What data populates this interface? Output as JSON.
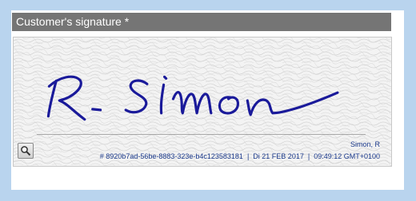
{
  "header": {
    "title": "Customer's signature *"
  },
  "signature": {
    "signer_name": "Simon, R",
    "hash": "# 8920b7ad-56be-8883-323e-b4c123583181",
    "date": "Di 21 FEB 2017",
    "time": "09:49:12 GMT+0100",
    "separator": "|",
    "ink_color": "#1a1a9a"
  },
  "tools": {
    "zoom_icon": "magnifier-icon"
  },
  "colors": {
    "page_bg": "#b9d4ee",
    "header_bg": "#757575",
    "meta_text": "#1b3a8c"
  }
}
